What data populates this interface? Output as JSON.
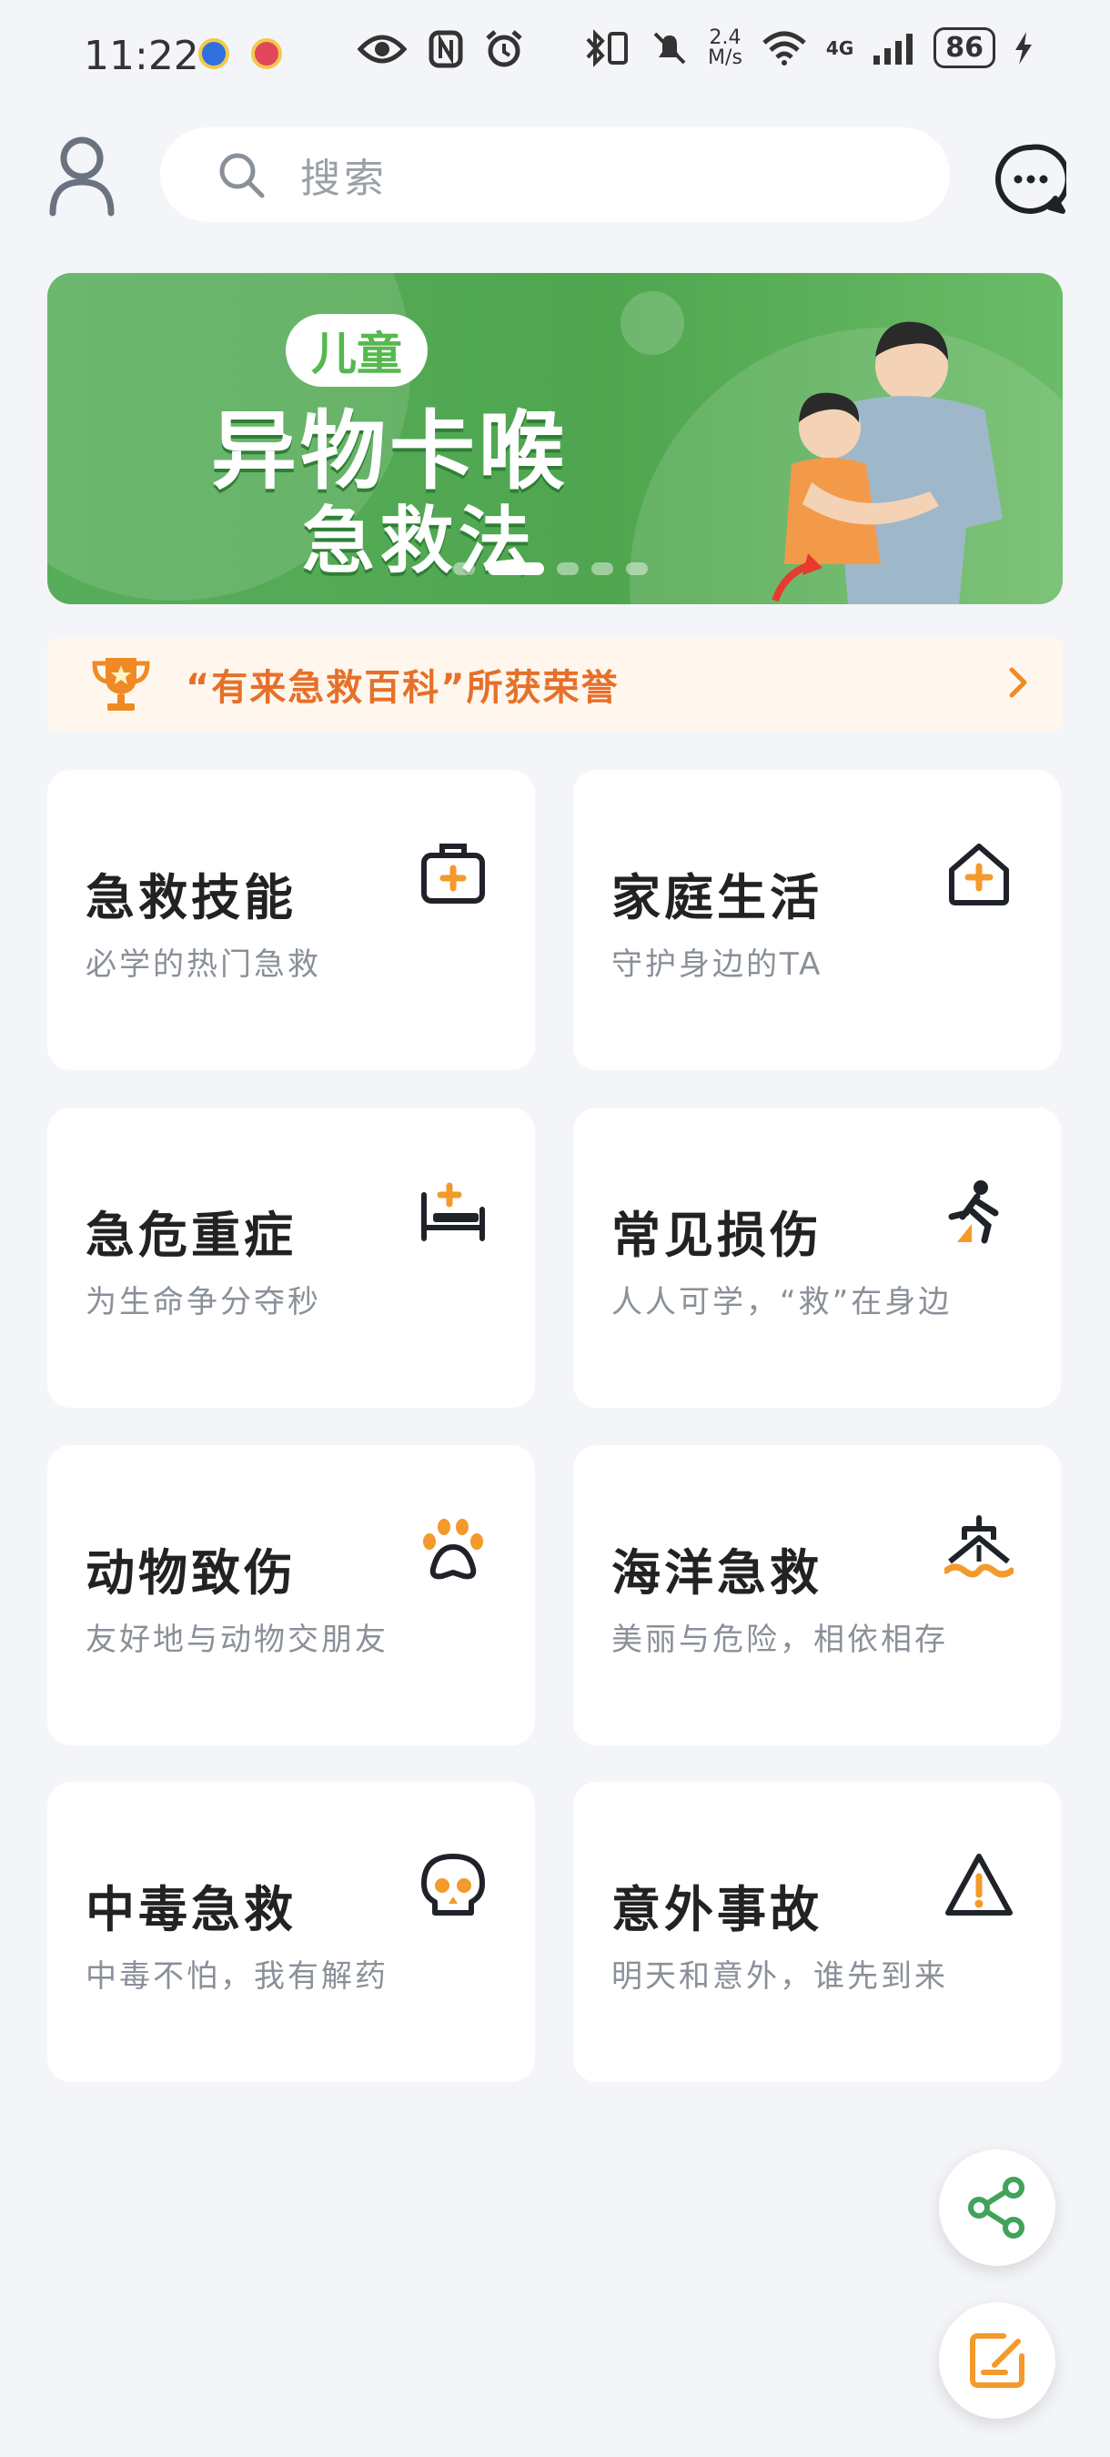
{
  "status_bar": {
    "time": "11:22",
    "net_speed_top": "2.4",
    "net_speed_unit": "M/s",
    "network": "4G",
    "battery": "86"
  },
  "header": {
    "search_placeholder": "搜索"
  },
  "banner": {
    "tag": "儿童",
    "title_line1": "异物卡喉",
    "title_line2": "急救法",
    "page_count": 5,
    "active_page": 2
  },
  "honor_bar": {
    "text": "“有来急救百科”所获荣誉"
  },
  "cards": [
    {
      "title": "急救技能",
      "subtitle": "必学的热门急救",
      "icon": "first-aid-kit-icon"
    },
    {
      "title": "家庭生活",
      "subtitle": "守护身边的TA",
      "icon": "home-medical-icon"
    },
    {
      "title": "急危重症",
      "subtitle": "为生命争分夺秒",
      "icon": "hospital-bed-icon"
    },
    {
      "title": "常见损伤",
      "subtitle": "人人可学，“救”在身边",
      "icon": "fall-injury-icon"
    },
    {
      "title": "动物致伤",
      "subtitle": "友好地与动物交朋友",
      "icon": "paw-icon"
    },
    {
      "title": "海洋急救",
      "subtitle": "美丽与危险，相依相存",
      "icon": "ship-icon"
    },
    {
      "title": "中毒急救",
      "subtitle": "中毒不怕，我有解药",
      "icon": "skull-icon"
    },
    {
      "title": "意外事故",
      "subtitle": "明天和意外，谁先到来",
      "icon": "warning-icon"
    }
  ],
  "colors": {
    "accent_orange": "#f39a2b",
    "icon_dark": "#1f2329",
    "share_green": "#3fa45a"
  }
}
